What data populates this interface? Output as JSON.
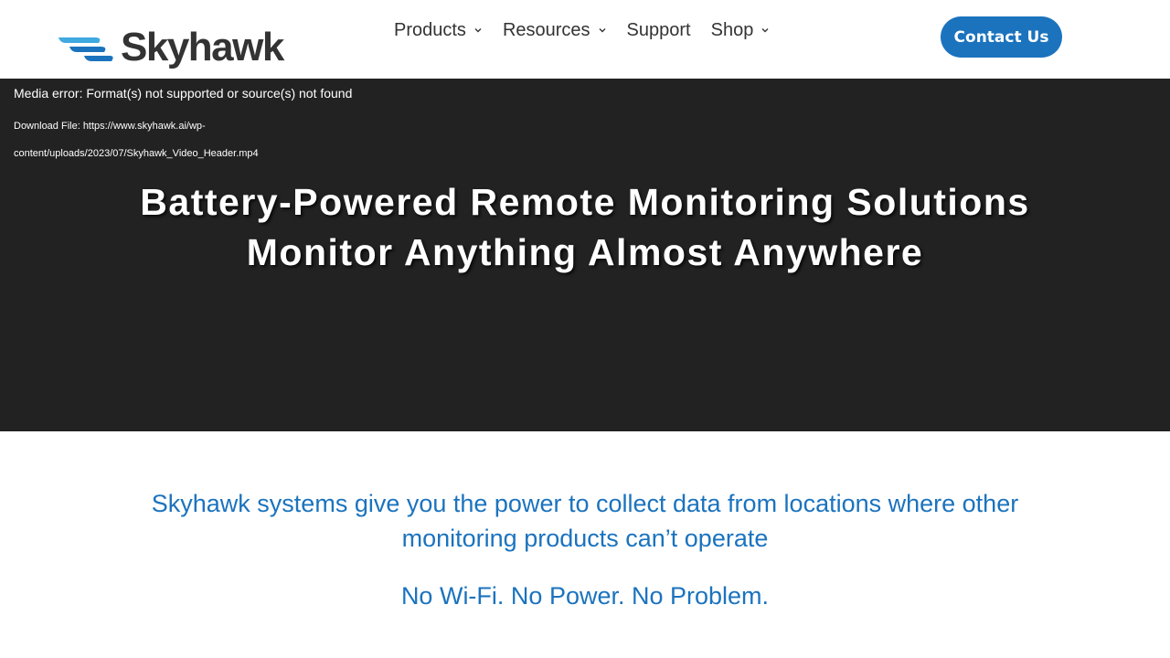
{
  "brand": {
    "name": "Skyhawk",
    "logo_color": "#333333",
    "accent_color": "#1b73be",
    "logo_stripe_colors": [
      "#1b73be",
      "#3fa9e0"
    ]
  },
  "nav": {
    "items": [
      {
        "label": "Products",
        "has_dropdown": true,
        "icon": "chevron-down-icon"
      },
      {
        "label": "Resources",
        "has_dropdown": true,
        "icon": "chevron-down-icon"
      },
      {
        "label": "Support",
        "has_dropdown": false
      },
      {
        "label": "Shop",
        "has_dropdown": true,
        "icon": "chevron-down-icon"
      }
    ],
    "contact_label": "Contact Us"
  },
  "hero": {
    "background": "#222222",
    "media_error": "Media error: Format(s) not supported or source(s) not found",
    "download_line1": "Download File: https://www.skyhawk.ai/wp-",
    "download_line2": "content/uploads/2023/07/Skyhawk_Video_Header.mp4",
    "title": "Battery-Powered Remote Monitoring Solutions",
    "subtitle": "Monitor Anything Almost Anywhere"
  },
  "content": {
    "intro": "Skyhawk systems give you the power to collect data from locations where other monitoring products can’t operate",
    "tagline": "No Wi-Fi. No Power. No Problem."
  }
}
